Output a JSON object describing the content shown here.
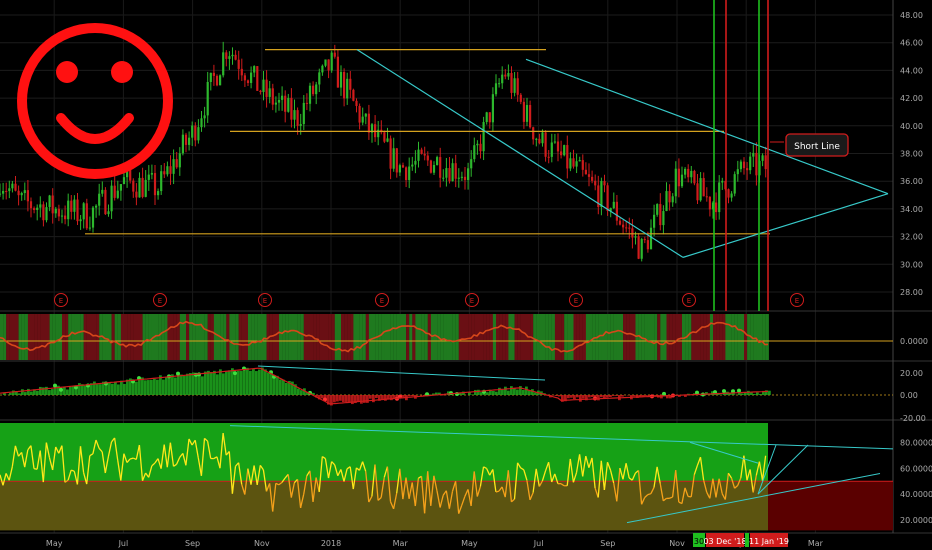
{
  "chart_data": [
    {
      "type": "candlestick",
      "panel": "price",
      "x_labels": [
        "May",
        "Jul",
        "Sep",
        "Nov",
        "2018",
        "Mar",
        "May",
        "Jul",
        "Sep",
        "Nov",
        "Jan",
        "Mar"
      ],
      "y_ticks": [
        "48.00",
        "46.00",
        "44.00",
        "42.00",
        "40.00",
        "38.00",
        "36.00",
        "34.00",
        "32.00",
        "30.00",
        "28.00"
      ],
      "ylim": [
        27,
        48.5
      ],
      "approx_close_path": [
        {
          "x": "Mar 2017",
          "y": 37.5
        },
        {
          "x": "Apr 2017",
          "y": 34.5
        },
        {
          "x": "May 2017",
          "y": 34.0
        },
        {
          "x": "Jun 2017",
          "y": 33.5
        },
        {
          "x": "Jul 2017",
          "y": 36.0
        },
        {
          "x": "Aug 2017",
          "y": 35.5
        },
        {
          "x": "Sep 2017",
          "y": 39.5
        },
        {
          "x": "Oct 2017",
          "y": 45.8
        },
        {
          "x": "Nov 2017",
          "y": 42.5
        },
        {
          "x": "Dec 2017",
          "y": 40.5
        },
        {
          "x": "Jan 2018",
          "y": 44.5
        },
        {
          "x": "Feb 2018",
          "y": 40.0
        },
        {
          "x": "Mar 2018",
          "y": 37.0
        },
        {
          "x": "Apr 2018",
          "y": 37.5
        },
        {
          "x": "May 2018",
          "y": 36.5
        },
        {
          "x": "Jun 2018",
          "y": 44.0
        },
        {
          "x": "Jul 2018",
          "y": 39.0
        },
        {
          "x": "Aug 2018",
          "y": 37.0
        },
        {
          "x": "Sep 2018",
          "y": 34.5
        },
        {
          "x": "Oct 2018",
          "y": 31.0
        },
        {
          "x": "Nov 2018",
          "y": 36.5
        },
        {
          "x": "Dec 2018",
          "y": 34.5
        },
        {
          "x": "Jan 2019",
          "y": 37.0
        }
      ],
      "horizontal_levels": [
        45.5,
        39.6,
        32.2
      ],
      "earnings_markers": [
        "E",
        "E",
        "E",
        "E",
        "E",
        "E",
        "E",
        "E"
      ],
      "annotation": "Short Line",
      "date_badges": [
        "03 Dec '18",
        "11 Jan '19"
      ],
      "date_badge_small": "30"
    },
    {
      "type": "area",
      "panel": "oscillator-1",
      "y_ticks": [
        "0.0000"
      ]
    },
    {
      "type": "histogram",
      "panel": "oscillator-2",
      "y_ticks": [
        "20.00",
        "0.00",
        "-20.00"
      ]
    },
    {
      "type": "line",
      "panel": "oscillator-3",
      "y_ticks": [
        "80.0000",
        "60.0000",
        "40.0000",
        "20.0000"
      ],
      "threshold": 50
    }
  ],
  "colors": {
    "bull": "#2db82d",
    "bear": "#d01c1c",
    "level": "#d4a11e",
    "trend": "#37c9c9",
    "smiley": "#ff1111",
    "osc_line": "#ffe81a",
    "osc_line_low": "#f5a11a"
  },
  "icon": "smiley-face-icon"
}
